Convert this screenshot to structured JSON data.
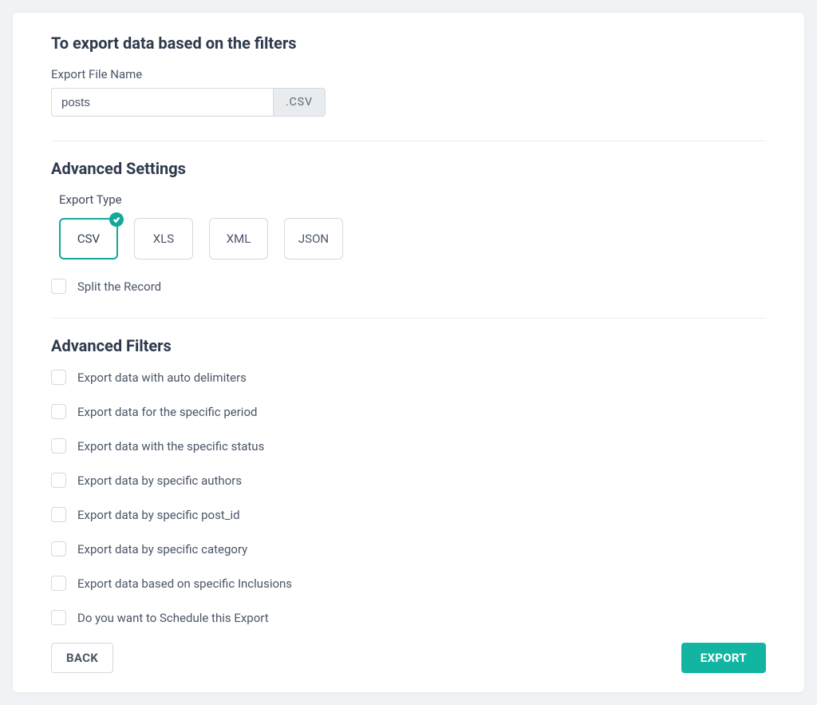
{
  "colors": {
    "accent": "#13a999",
    "primary_btn": "#11b5a2"
  },
  "header": {
    "title": "To export data based on the filters"
  },
  "file": {
    "label": "Export File Name",
    "value": "posts",
    "ext_label": ".CSV"
  },
  "advanced": {
    "title": "Advanced Settings",
    "export_type_label": "Export Type",
    "types": [
      {
        "label": "CSV",
        "selected": true
      },
      {
        "label": "XLS",
        "selected": false
      },
      {
        "label": "XML",
        "selected": false
      },
      {
        "label": "JSON",
        "selected": false
      }
    ],
    "split_label": "Split the Record"
  },
  "filters": {
    "title": "Advanced Filters",
    "items": [
      {
        "label": "Export data with auto delimiters"
      },
      {
        "label": "Export data for the specific period"
      },
      {
        "label": "Export data with the specific status"
      },
      {
        "label": "Export data by specific authors"
      },
      {
        "label": "Export data by specific post_id"
      },
      {
        "label": "Export data by specific category"
      },
      {
        "label": "Export data based on specific Inclusions"
      },
      {
        "label": "Do you want to Schedule this Export"
      }
    ]
  },
  "footer": {
    "back": "BACK",
    "export": "EXPORT"
  }
}
